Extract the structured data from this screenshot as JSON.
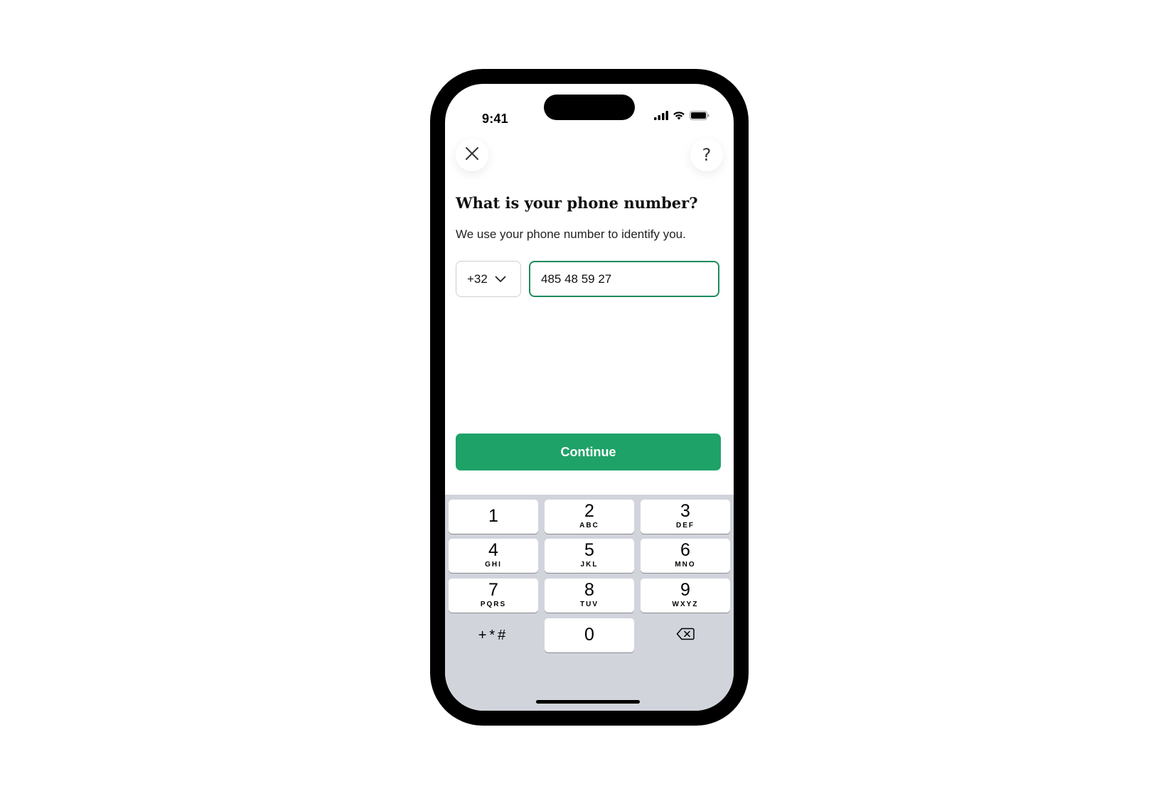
{
  "status_bar": {
    "time": "9:41",
    "icons": [
      "cellular-signal-icon",
      "wifi-icon",
      "battery-icon"
    ]
  },
  "header": {
    "close_icon": "close-icon",
    "help_label": "?"
  },
  "content": {
    "title": "What is your phone number?",
    "subtitle": "We use your phone number to identify you."
  },
  "phone_form": {
    "country_code": "+32",
    "phone_value": "485 48 59 27"
  },
  "actions": {
    "continue_label": "Continue"
  },
  "keypad": {
    "keys": [
      {
        "digit": "1",
        "letters": ""
      },
      {
        "digit": "2",
        "letters": "ABC"
      },
      {
        "digit": "3",
        "letters": "DEF"
      },
      {
        "digit": "4",
        "letters": "GHI"
      },
      {
        "digit": "5",
        "letters": "JKL"
      },
      {
        "digit": "6",
        "letters": "MNO"
      },
      {
        "digit": "7",
        "letters": "PQRS"
      },
      {
        "digit": "8",
        "letters": "TUV"
      },
      {
        "digit": "9",
        "letters": "WXYZ"
      },
      {
        "digit": "0",
        "letters": ""
      }
    ],
    "symbols_label": "+*#"
  },
  "colors": {
    "accent": "#1ea267",
    "input_focus_border": "#1c8a5c",
    "keyboard_background": "#d1d4db"
  }
}
